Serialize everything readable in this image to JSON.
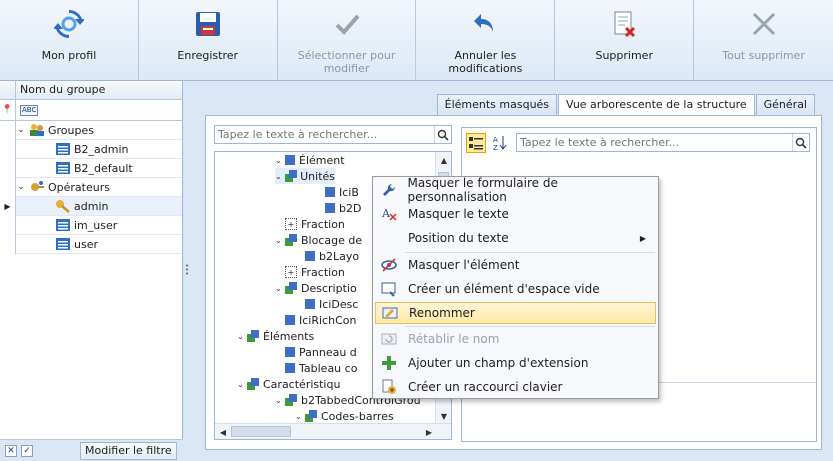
{
  "toolbar": {
    "buttons": [
      {
        "label": "Mon profil",
        "icon": "refresh-icon",
        "disabled": false
      },
      {
        "label": "Enregistrer",
        "icon": "save-icon",
        "disabled": false
      },
      {
        "label": "Sélectionner pour modifier",
        "icon": "checkmark-icon",
        "disabled": true
      },
      {
        "label": "Annuler les modifications",
        "icon": "undo-icon",
        "disabled": false
      },
      {
        "label": "Supprimer",
        "icon": "delete-doc-icon",
        "disabled": false
      },
      {
        "label": "Tout supprimer",
        "icon": "delete-all-icon",
        "disabled": true
      }
    ]
  },
  "left_panel": {
    "column_header": "Nom du groupe",
    "tree": [
      {
        "label": "Groupes",
        "level": 0,
        "expanded": true,
        "icon": "groups-icon"
      },
      {
        "label": "B2_admin",
        "level": 1,
        "icon": "group-item-icon"
      },
      {
        "label": "B2_default",
        "level": 1,
        "icon": "group-item-icon"
      },
      {
        "label": "Opérateurs",
        "level": 0,
        "expanded": true,
        "icon": "operators-icon"
      },
      {
        "label": "admin",
        "level": 1,
        "icon": "key-icon",
        "selected": true
      },
      {
        "label": "im_user",
        "level": 1,
        "icon": "group-item-icon"
      },
      {
        "label": "user",
        "level": 1,
        "icon": "group-item-icon"
      }
    ],
    "filter_button": "Modifier le filtre"
  },
  "tabs": [
    {
      "label": "Éléments masqués",
      "active": false
    },
    {
      "label": "Vue arborescente de la structure",
      "active": true
    },
    {
      "label": "Général",
      "active": false
    }
  ],
  "structure_search": {
    "placeholder": "Tapez le texte à rechercher..."
  },
  "property_search": {
    "placeholder": "Tapez le texte à rechercher..."
  },
  "structure_tree": [
    {
      "label": "Élément",
      "arrow": true,
      "icon": "blue"
    },
    {
      "label": "Unités",
      "arrow": true,
      "icon": "combo",
      "selected": true
    },
    {
      "label": "IciB",
      "arrow": false,
      "icon": "blue"
    },
    {
      "label": "b2D",
      "arrow": false,
      "icon": "blue"
    },
    {
      "label": "Fraction",
      "arrow": false,
      "icon": "frac"
    },
    {
      "label": "Blocage de",
      "arrow": true,
      "icon": "combo"
    },
    {
      "label": "b2Layo",
      "arrow": false,
      "icon": "blue"
    },
    {
      "label": "Fraction",
      "arrow": false,
      "icon": "frac"
    },
    {
      "label": "Descriptio",
      "arrow": true,
      "icon": "combo"
    },
    {
      "label": "IciDesc",
      "arrow": false,
      "icon": "blue"
    },
    {
      "label": "IciRichCon",
      "arrow": false,
      "icon": "blue"
    },
    {
      "label": "Éléments",
      "arrow": true,
      "icon": "combo"
    },
    {
      "label": "Panneau d",
      "arrow": false,
      "icon": "blue"
    },
    {
      "label": "Tableau co",
      "arrow": false,
      "icon": "blue"
    },
    {
      "label": "Caractéristiqu",
      "arrow": true,
      "icon": "combo"
    },
    {
      "label": "b2TabbedControlGrou",
      "arrow": true,
      "icon": "combo"
    },
    {
      "label": "Codes-barres",
      "arrow": true,
      "icon": "combo"
    }
  ],
  "context_menu": {
    "items": [
      {
        "label": "Masquer le formulaire de personnalisation",
        "icon": "wrench-icon"
      },
      {
        "label": "Masquer le texte",
        "icon": "text-icon"
      },
      {
        "label": "Position du texte",
        "icon": "",
        "submenu": true
      },
      {
        "label": "Masquer l'élément",
        "icon": "hide-eye-icon"
      },
      {
        "label": "Créer un élément d'espace vide",
        "icon": "empty-space-icon"
      },
      {
        "label": "Renommer",
        "icon": "rename-icon",
        "highlighted": true
      },
      {
        "label": "Rétablir le nom",
        "icon": "reset-name-icon",
        "disabled": true
      },
      {
        "label": "Ajouter un champ d'extension",
        "icon": "plus-icon"
      },
      {
        "label": "Créer un raccourci clavier",
        "icon": "shortcut-icon"
      }
    ]
  }
}
